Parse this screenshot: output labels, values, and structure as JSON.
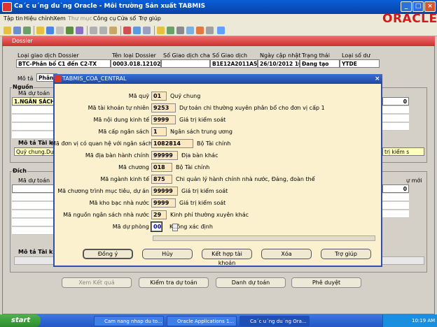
{
  "window": {
    "title": "Ca´c u´ng du˙ng Oracle - Môi trường Sản xuất TABMIS"
  },
  "menu": [
    "Tập tin",
    "Hiệu chỉnh",
    "Xem",
    "Thư mục",
    "Công cụ",
    "Cửa sổ",
    "Trợ giúp"
  ],
  "oracle_logo": "ORACLE",
  "dossier": {
    "title": "Dossier",
    "col_labels": [
      "Loại giao dịch Dossier",
      "Tên loại Dossier",
      "Số Giao dịch cha",
      "Số Giao dịch",
      "Ngày cập nhật",
      "Trạng thái",
      "Loại số dư"
    ],
    "values": [
      "BTC-Phân bổ C1 đến C2-TX",
      "0003.018.121026.k",
      "",
      "B1E12A2011A52",
      "26/10/2012 10:0",
      "Đang tạo",
      "YTDE"
    ],
    "mota_label": "Mô tả",
    "mota_value": "Phân b",
    "nguon": "Nguồn",
    "ma_du_toan": "Mã dự toán",
    "nguon_row1": "1.NGÂN SÁCH",
    "zero": "0",
    "mota_tai_khoan": "Mô tả Tài khoả",
    "mota_tk_value": "Quỹ chung.Dự",
    "tri_kiem": "trị kiểm s",
    "dich": "Đích",
    "ma_du_toan2": "Mã dự toán",
    "zero2": "0",
    "mota_tai_khoan2": "Mô tả Tài khoả",
    "right_mo": "ự mới"
  },
  "dialog": {
    "title": "TABMIS_COA_CENTRAL",
    "fields": [
      {
        "label": "Mã quỹ",
        "value": "01",
        "desc": "Quỹ chung"
      },
      {
        "label": "Mã tài khoản tự nhiên",
        "value": "9253",
        "desc": "Dự toán chi thường xuyên phân bổ cho đơn vị cấp 1"
      },
      {
        "label": "Mã nội dung kinh tế",
        "value": "9999",
        "desc": "Giá trị kiểm soát"
      },
      {
        "label": "Mã cấp ngân sách",
        "value": "1",
        "desc": "Ngân sách trung ương"
      },
      {
        "label": "Mã đơn vị có quan hệ với ngân sách",
        "value": "1082814",
        "desc": "Bộ Tài chính"
      },
      {
        "label": "Mã địa bàn hành chính",
        "value": "99999",
        "desc": "Địa bàn khác"
      },
      {
        "label": "Mã chương",
        "value": "018",
        "desc": "Bộ Tài chính"
      },
      {
        "label": "Mã ngành kinh tế",
        "value": "875",
        "desc": "Chi quản lý hành chính nhà nước, Đảng, đoàn thể"
      },
      {
        "label": "Mã chương trình mục tiêu, dự án",
        "value": "99999",
        "desc": "Giá trị kiểm soát"
      },
      {
        "label": "Mã kho bạc nhà nước",
        "value": "9999",
        "desc": "Giá trị kiểm soát"
      },
      {
        "label": "Mã nguồn ngân sách nhà nước",
        "value": "29",
        "desc": "Kinh phí thường xuyên khác"
      },
      {
        "label": "Mã dự phòng",
        "value": "000",
        "desc": "Không xác định"
      }
    ],
    "buttons": [
      "Đồng ý",
      "Hủy",
      "Kết hợp tài khoản",
      "Xóa",
      "Trợ giúp"
    ]
  },
  "bottom_buttons": [
    "Xem Kết quả",
    "Kiểm tra dự toán",
    "Danh dự toán",
    "Phê duyệt"
  ],
  "taskbar": {
    "start": "start",
    "tasks": [
      "Cam nang nhap du to...",
      "Oracle Applications 1...",
      "Ca´c u´ng du˙ng Ora..."
    ],
    "time": "10:19 AM"
  }
}
